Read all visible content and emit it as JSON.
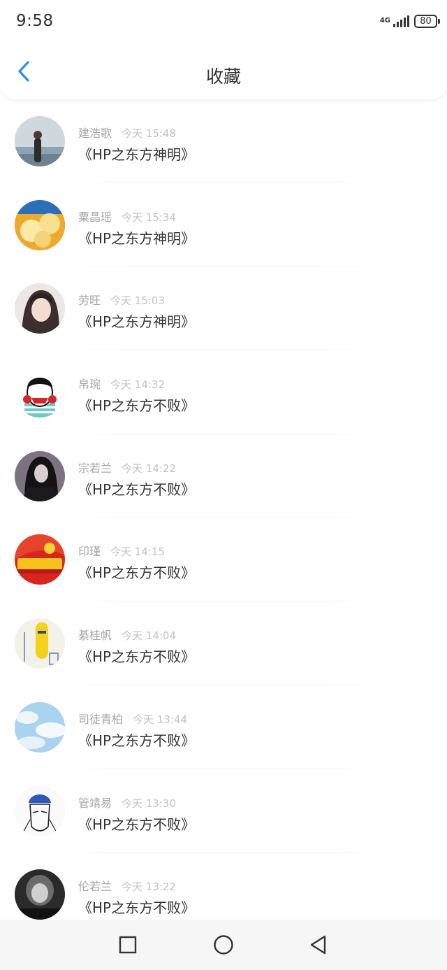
{
  "status_bar": {
    "time": "9:58",
    "network": "4G",
    "battery": "80"
  },
  "header": {
    "back_icon": "chevron-left-icon",
    "title": "收藏",
    "accent_color": "#2c8de6"
  },
  "favorites": [
    {
      "name": "建浩歌",
      "time": "今天 15:48",
      "book": "《HP之东方神明》",
      "avatar": "avatar-woman-by-sea"
    },
    {
      "name": "粟晶瑶",
      "time": "今天 15:34",
      "book": "《HP之东方神明》",
      "avatar": "avatar-dessert"
    },
    {
      "name": "劳旺",
      "time": "今天 15:03",
      "book": "《HP之东方神明》",
      "avatar": "avatar-anime-girl"
    },
    {
      "name": "帛琬",
      "time": "今天 14:32",
      "book": "《HP之东方不败》",
      "avatar": "avatar-cartoon-face"
    },
    {
      "name": "宗若兰",
      "time": "今天 14:22",
      "book": "《HP之东方不败》",
      "avatar": "avatar-dark-portrait"
    },
    {
      "name": "印瑾",
      "time": "今天 14:15",
      "book": "《HP之东方不败》",
      "avatar": "avatar-army-day"
    },
    {
      "name": "綦桂帆",
      "time": "今天 14:04",
      "book": "《HP之东方不败》",
      "avatar": "avatar-corn-cartoon"
    },
    {
      "name": "司徒青柏",
      "time": "今天 13:44",
      "book": "《HP之东方不败》",
      "avatar": "avatar-sky-clouds"
    },
    {
      "name": "管靖易",
      "time": "今天 13:30",
      "book": "《HP之东方不败》",
      "avatar": "avatar-sketch-face"
    },
    {
      "name": "伦若兰",
      "time": "今天 13:22",
      "book": "《HP之东方不败》",
      "avatar": "avatar-bw-photo"
    }
  ],
  "nav_bar": {
    "recent_icon": "square-icon",
    "home_icon": "circle-icon",
    "back_icon": "triangle-back-icon"
  }
}
